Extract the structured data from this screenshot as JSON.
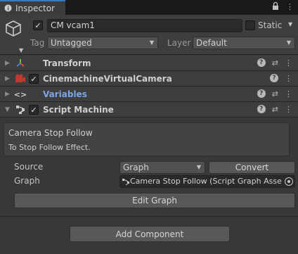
{
  "tab": {
    "title": "Inspector"
  },
  "header": {
    "name": "CM vcam1",
    "static_label": "Static",
    "tag_label": "Tag",
    "tag_value": "Untagged",
    "layer_label": "Layer",
    "layer_value": "Default"
  },
  "components": [
    {
      "title": "Transform",
      "icon": "transform-icon"
    },
    {
      "title": "CinemachineVirtualCamera",
      "icon": "cinemachine-icon"
    },
    {
      "title": "Variables",
      "icon": "variables-icon"
    },
    {
      "title": "Script Machine",
      "icon": "script-machine-icon"
    }
  ],
  "script_machine": {
    "graph_title": "Camera Stop Follow",
    "graph_description": "To Stop Follow Effect.",
    "source_label": "Source",
    "source_value": "Graph",
    "convert_label": "Convert",
    "graph_label": "Graph",
    "graph_value": "Camera Stop Follow (Script Graph Asse",
    "edit_graph_label": "Edit Graph"
  },
  "add_component_label": "Add Component",
  "colors": {
    "accent": "#3a79bb",
    "background": "#383838",
    "variables_title": "#7fa6e4"
  }
}
